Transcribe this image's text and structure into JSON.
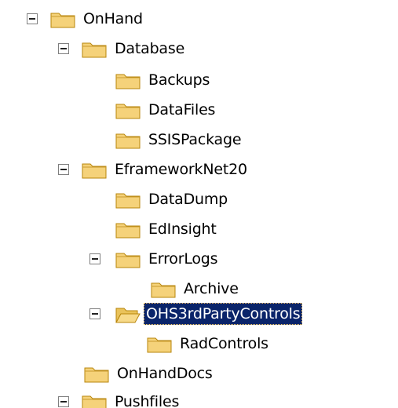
{
  "tree": {
    "nodes": [
      {
        "label": "OnHand",
        "expander": "collapse",
        "selected": false
      },
      {
        "label": "Database",
        "expander": "collapse",
        "selected": false
      },
      {
        "label": "Backups",
        "expander": null,
        "selected": false
      },
      {
        "label": "DataFiles",
        "expander": null,
        "selected": false
      },
      {
        "label": "SSISPackage",
        "expander": null,
        "selected": false
      },
      {
        "label": "EframeworkNet20",
        "expander": "collapse",
        "selected": false
      },
      {
        "label": "DataDump",
        "expander": null,
        "selected": false
      },
      {
        "label": "EdInsight",
        "expander": null,
        "selected": false
      },
      {
        "label": "ErrorLogs",
        "expander": "collapse",
        "selected": false
      },
      {
        "label": "Archive",
        "expander": null,
        "selected": false
      },
      {
        "label": "OHS3rdPartyControls",
        "expander": "collapse",
        "selected": true
      },
      {
        "label": "RadControls",
        "expander": null,
        "selected": false
      },
      {
        "label": "OnHandDocs",
        "expander": null,
        "selected": false
      },
      {
        "label": "Pushfiles",
        "expander": "collapse",
        "selected": false
      }
    ]
  },
  "colors": {
    "selection_bg": "#0a246a",
    "selection_text": "#ffffff",
    "folder_fill": "#f5d27a",
    "folder_edge": "#b8860b"
  }
}
